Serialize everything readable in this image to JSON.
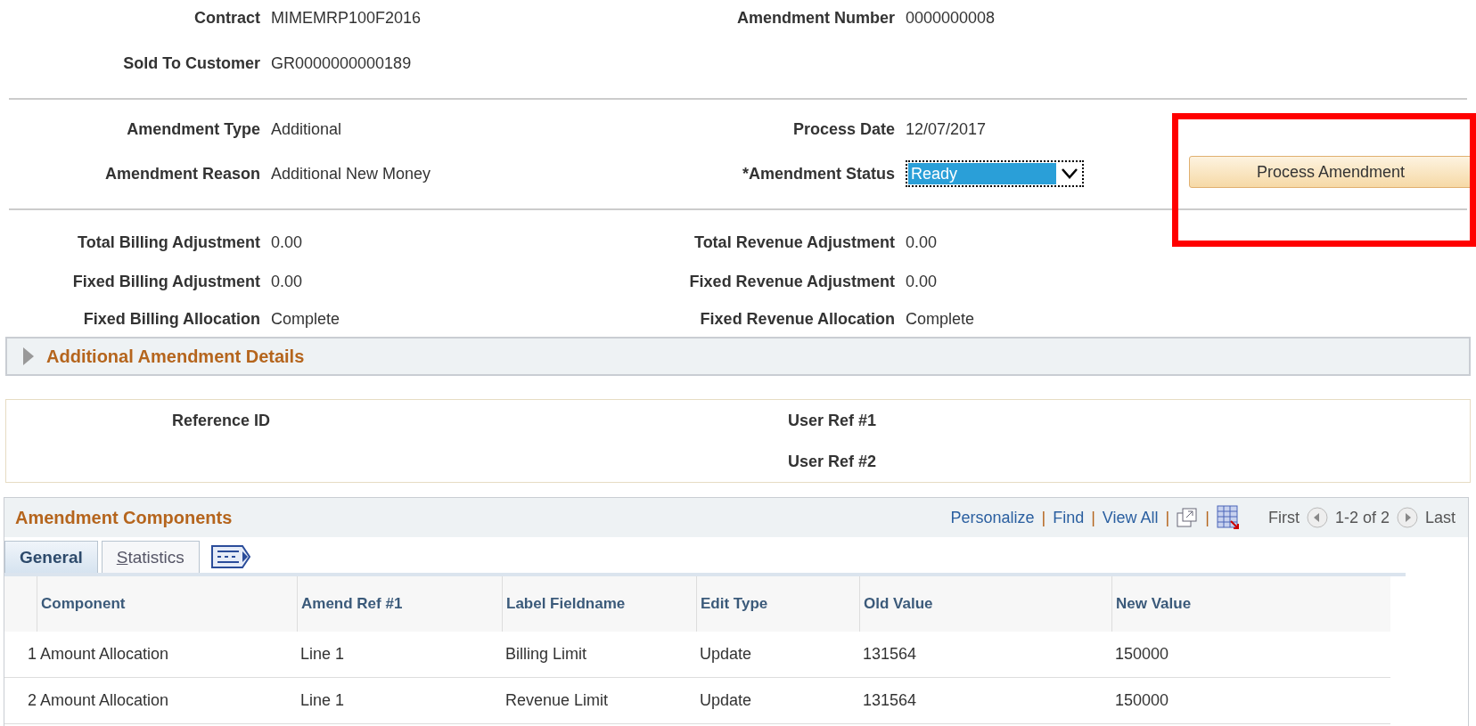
{
  "header": [
    {
      "label": "Contract",
      "value": "MIMEMRP100F2016"
    },
    {
      "label": "Amendment Number",
      "value": "0000000008"
    },
    {
      "label": "Sold To Customer",
      "value": "GR0000000000189"
    }
  ],
  "amendment": {
    "type_label": "Amendment Type",
    "type_value": "Additional",
    "reason_label": "Amendment Reason",
    "reason_value": "Additional New Money",
    "date_label": "Process Date",
    "date_value": "12/07/2017",
    "status_label": "*Amendment Status",
    "status_value": "Ready",
    "status_selected": true,
    "process_button": "Process Amendment",
    "highlighted": true
  },
  "adjustments": [
    {
      "label": "Total Billing Adjustment",
      "value": "0.00"
    },
    {
      "label": "Total Revenue Adjustment",
      "value": "0.00"
    },
    {
      "label": "Fixed Billing Adjustment",
      "value": "0.00"
    },
    {
      "label": "Fixed Revenue Adjustment",
      "value": "0.00"
    },
    {
      "label": "Fixed Billing Allocation",
      "value": "Complete"
    },
    {
      "label": "Fixed Revenue Allocation",
      "value": "Complete"
    }
  ],
  "details_section": {
    "title": "Additional Amendment Details",
    "expanded": false
  },
  "references": {
    "reference_id": "Reference ID",
    "user_ref_1": "User Ref #1",
    "user_ref_2": "User Ref #2"
  },
  "grid": {
    "title": "Amendment Components",
    "links": [
      "Personalize",
      "Find",
      "View All"
    ],
    "separators": [
      "|",
      "|",
      "|",
      "|"
    ],
    "first": "First",
    "range": "1-2 of 2",
    "last": "Last",
    "tabs": [
      {
        "label": "General",
        "selected": true
      },
      {
        "label": "Statistics",
        "selected": false
      }
    ],
    "columns": [
      "Component",
      "Amend Ref #1",
      "Label Fieldname",
      "Edit Type",
      "Old Value",
      "New Value"
    ],
    "rows": [
      {
        "number": "1",
        "cells": [
          "Amount Allocation",
          "Line 1",
          "Billing Limit",
          "Update",
          "131564",
          "150000"
        ]
      },
      {
        "number": "2",
        "cells": [
          "Amount Allocation",
          "Line 1",
          "Revenue Limit",
          "Update",
          "131564",
          "150000"
        ]
      }
    ]
  }
}
